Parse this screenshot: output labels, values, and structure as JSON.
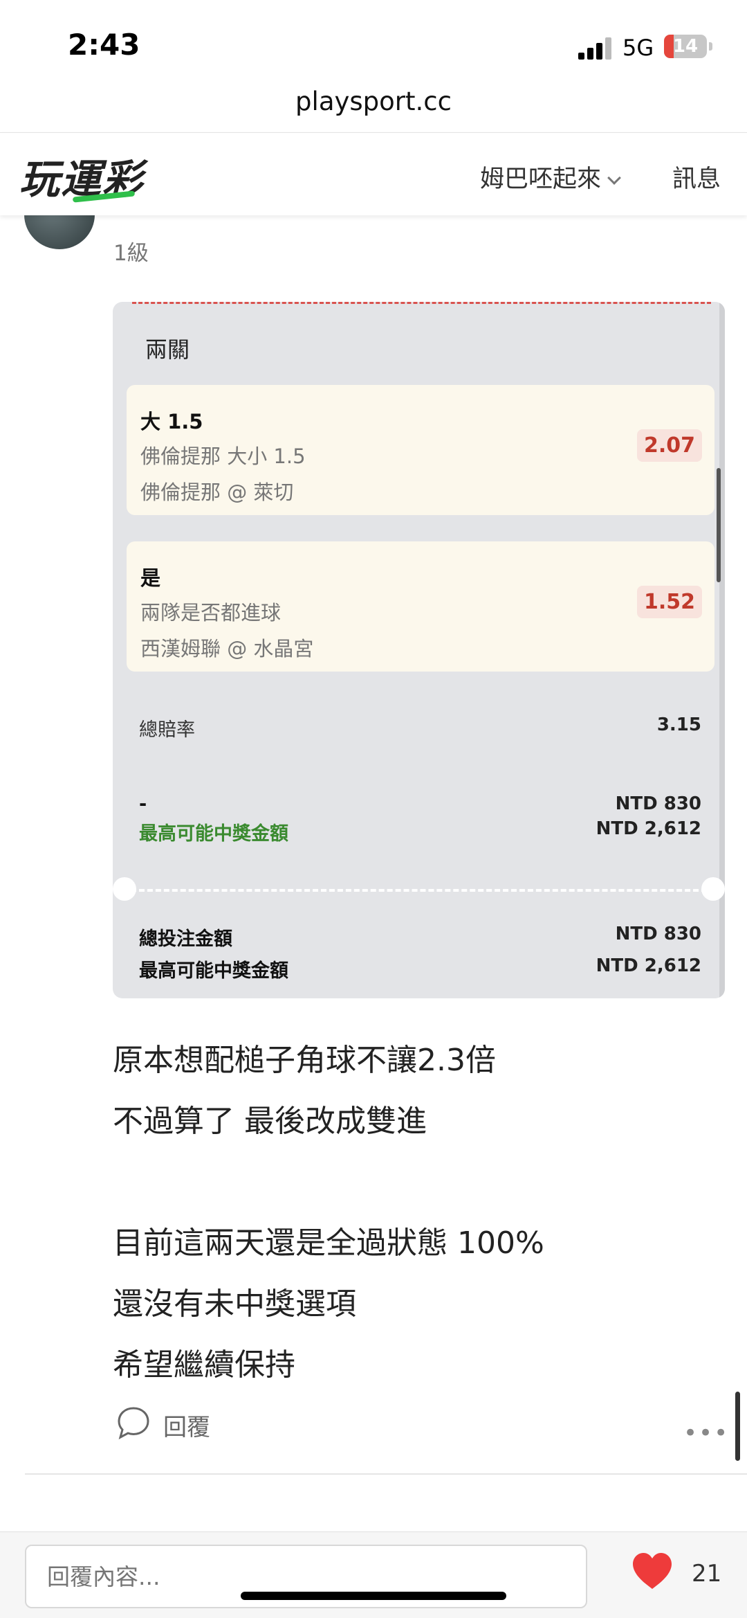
{
  "status_bar": {
    "time": "2:43",
    "network": "5G",
    "battery": "14"
  },
  "browser": {
    "url": "playsport.cc"
  },
  "nav": {
    "logo": "玩運彩",
    "user": "姆巴呸起來",
    "messages": "訊息"
  },
  "post": {
    "user_level": "1級",
    "ticket": {
      "type": "兩關",
      "bets": [
        {
          "selection": "大 1.5",
          "market": "佛倫提那 大小 1.5",
          "match": "佛倫提那 @ 萊切",
          "odds": "2.07"
        },
        {
          "selection": "是",
          "market": "兩隊是否都進球",
          "match": "西漢姆聯 @ 水晶宮",
          "odds": "1.52"
        }
      ],
      "total_odds_label": "總賠率",
      "total_odds": "3.15",
      "stake_label": "-",
      "stake": "NTD 830",
      "max_win_label": "最高可能中獎金額",
      "max_win": "NTD 2,612",
      "total_stake_label": "總投注金額",
      "total_stake": "NTD 830",
      "total_max_win_label": "最高可能中獎金額",
      "total_max_win": "NTD 2,612"
    },
    "lines": [
      "原本想配槌子角球不讓2.3倍",
      "不過算了 最後改成雙進",
      "",
      "目前這兩天還是全過狀態 100%",
      "還沒有未中獎選項",
      "希望繼續保持"
    ],
    "reply_label": "回覆",
    "more": "•••"
  },
  "bottom": {
    "reply_placeholder": "回覆內容...",
    "likes": "21"
  },
  "colors": {
    "accent_red": "#c0392b",
    "green": "#3a8a2f",
    "heart": "#ee3b3b"
  }
}
